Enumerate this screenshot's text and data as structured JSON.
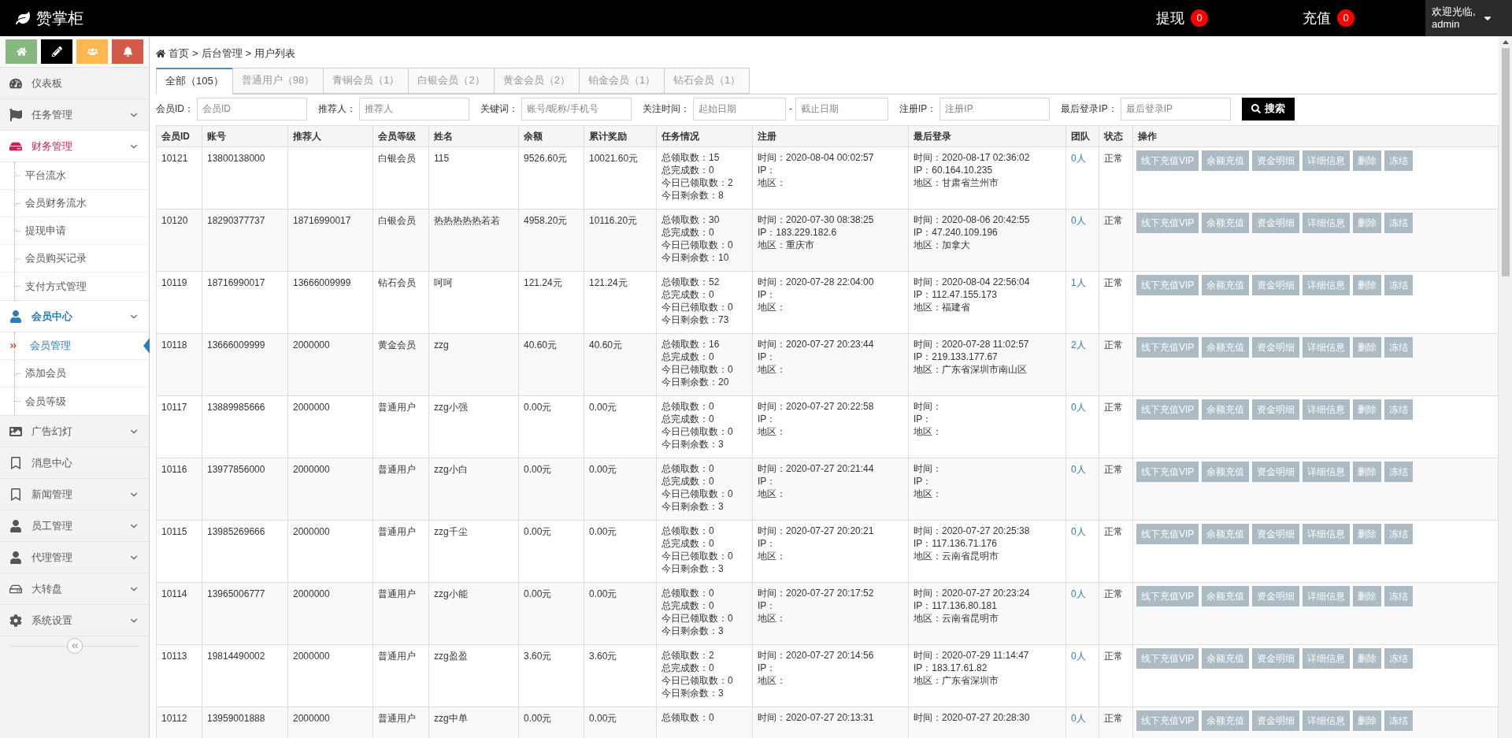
{
  "header": {
    "logo": "赞掌柜",
    "withdraw": {
      "label": "提现",
      "count": "0"
    },
    "recharge": {
      "label": "充值",
      "count": "0"
    },
    "user": {
      "greeting": "欢迎光临,",
      "name": "admin"
    }
  },
  "sidebar": {
    "shortcuts": [
      {
        "color": "#87b87f"
      },
      {
        "color": "#000000"
      },
      {
        "color": "#ffb752"
      },
      {
        "color": "#d15b47"
      }
    ],
    "menu": [
      {
        "label": "仪表板",
        "expandable": false,
        "selected": false
      },
      {
        "label": "任务管理",
        "expandable": true,
        "selected": false
      },
      {
        "label": "财务管理",
        "expandable": true,
        "selected": false,
        "color": "#c7254e",
        "expanded": true,
        "children": [
          {
            "label": "平台流水",
            "selected": false
          },
          {
            "label": "会员财务流水",
            "selected": false
          },
          {
            "label": "提现申请",
            "selected": false
          },
          {
            "label": "会员购买记录",
            "selected": false
          },
          {
            "label": "支付方式管理",
            "selected": false
          }
        ]
      },
      {
        "label": "会员中心",
        "expandable": true,
        "selected": true,
        "expanded": true,
        "children": [
          {
            "label": "会员管理",
            "selected": true
          },
          {
            "label": "添加会员",
            "selected": false
          },
          {
            "label": "会员等级",
            "selected": false
          }
        ]
      },
      {
        "label": "广告幻灯",
        "expandable": true,
        "selected": false
      },
      {
        "label": "消息中心",
        "expandable": false,
        "selected": false
      },
      {
        "label": "新闻管理",
        "expandable": true,
        "selected": false
      },
      {
        "label": "员工管理",
        "expandable": true,
        "selected": false
      },
      {
        "label": "代理管理",
        "expandable": true,
        "selected": false
      },
      {
        "label": "大转盘",
        "expandable": true,
        "selected": false
      },
      {
        "label": "系统设置",
        "expandable": true,
        "selected": false
      }
    ]
  },
  "breadcrumb": [
    "首页",
    ">",
    "后台管理",
    ">",
    "用户列表"
  ],
  "tabs": [
    {
      "label": "全部（105）",
      "selected": true
    },
    {
      "label": "普通用户（98）",
      "selected": false
    },
    {
      "label": "青铜会员（1）",
      "selected": false
    },
    {
      "label": "白银会员（2）",
      "selected": false
    },
    {
      "label": "黄金会员（2）",
      "selected": false
    },
    {
      "label": "铂金会员（1）",
      "selected": false
    },
    {
      "label": "钻石会员（1）",
      "selected": false
    }
  ],
  "filters": [
    {
      "label": "会员ID：",
      "fields": [
        {
          "placeholder": "会员ID"
        }
      ]
    },
    {
      "label": "推荐人：",
      "fields": [
        {
          "placeholder": "推荐人"
        }
      ]
    },
    {
      "label": "关键词：",
      "fields": [
        {
          "placeholder": "账号/昵称/手机号"
        }
      ]
    },
    {
      "label": "关注时间：",
      "fields": [
        {
          "placeholder": "起始日期"
        },
        {
          "placeholder": "截止日期"
        }
      ],
      "separator": "-"
    },
    {
      "label": "注册IP：",
      "fields": [
        {
          "placeholder": "注册IP"
        }
      ]
    },
    {
      "label": "最后登录IP：",
      "fields": [
        {
          "placeholder": "最后登录IP"
        }
      ]
    }
  ],
  "search_button": "搜索",
  "table": {
    "columns": [
      "会员ID",
      "账号",
      "推荐人",
      "会员等级",
      "姓名",
      "余额",
      "累计奖励",
      "任务情况",
      "注册",
      "最后登录",
      "团队",
      "状态",
      "操作"
    ],
    "rows": [
      {
        "id": "10121",
        "account": "13800138000",
        "level": "白银会员",
        "name": "115",
        "balance": "9526.60元",
        "reward": "10021.60元",
        "tasks": [
          "总领取数：15",
          "总完成数：0",
          "今日已领取数：2",
          "今日剩余数：8"
        ],
        "register": [
          "时间：2020-08-04 00:02:57",
          "IP：",
          "地区："
        ],
        "last_login": [
          "时间：2020-08-17 02:36:02",
          "IP：60.164.10.235",
          "地区：甘肃省兰州市"
        ],
        "team": "0人",
        "status": "正常",
        "actions": [
          "线下充值VIP",
          "余额充值",
          "资金明细",
          "详细信息",
          "删除",
          "冻结"
        ]
      },
      {
        "id": "10120",
        "account": "18290377737",
        "referrer": "18716990017",
        "level": "白银会员",
        "name": "热热热热热若若",
        "balance": "4958.20元",
        "reward": "10116.20元",
        "tasks": [
          "总领取数：30",
          "总完成数：0",
          "今日已领取数：0",
          "今日剩余数：10"
        ],
        "register": [
          "时间：2020-07-30 08:38:25",
          "IP：183.229.182.6",
          "地区：重庆市"
        ],
        "last_login": [
          "时间：2020-08-06 20:42:55",
          "IP：47.240.109.196",
          "地区：加拿大"
        ],
        "team": "0人",
        "status": "正常",
        "actions": [
          "线下充值VIP",
          "余额充值",
          "资金明细",
          "详细信息",
          "删除",
          "冻结"
        ]
      },
      {
        "id": "10119",
        "account": "18716990017",
        "referrer": "13666009999",
        "level": "钻石会员",
        "name": "呵呵",
        "balance": "121.24元",
        "reward": "121.24元",
        "tasks": [
          "总领取数：52",
          "总完成数：0",
          "今日已领取数：0",
          "今日剩余数：73"
        ],
        "register": [
          "时间：2020-07-28 22:04:00",
          "IP：",
          "地区："
        ],
        "last_login": [
          "时间：2020-08-04 22:56:04",
          "IP：112.47.155.173",
          "地区：福建省"
        ],
        "team": "1人",
        "status": "正常",
        "actions": [
          "线下充值VIP",
          "余额充值",
          "资金明细",
          "详细信息",
          "删除",
          "冻结"
        ]
      },
      {
        "id": "10118",
        "account": "13666009999",
        "referrer": "2000000",
        "level": "黄金会员",
        "name": "zzg",
        "balance": "40.60元",
        "reward": "40.60元",
        "tasks": [
          "总领取数：16",
          "总完成数：0",
          "今日已领取数：0",
          "今日剩余数：20"
        ],
        "register": [
          "时间：2020-07-27 20:23:44",
          "IP：",
          "地区："
        ],
        "last_login": [
          "时间：2020-07-28 11:02:57",
          "IP：219.133.177.67",
          "地区：广东省深圳市南山区"
        ],
        "team": "2人",
        "status": "正常",
        "actions": [
          "线下充值VIP",
          "余额充值",
          "资金明细",
          "详细信息",
          "删除",
          "冻结"
        ]
      },
      {
        "id": "10117",
        "account": "13889985666",
        "referrer": "2000000",
        "level": "普通用户",
        "name": "zzg小强",
        "balance": "0.00元",
        "reward": "0.00元",
        "tasks": [
          "总领取数：0",
          "总完成数：0",
          "今日已领取数：0",
          "今日剩余数：3"
        ],
        "register": [
          "时间：2020-07-27 20:22:58",
          "IP：",
          "地区："
        ],
        "last_login": [
          "时间：",
          "IP：",
          "地区："
        ],
        "team": "0人",
        "status": "正常",
        "actions": [
          "线下充值VIP",
          "余额充值",
          "资金明细",
          "详细信息",
          "删除",
          "冻结"
        ]
      },
      {
        "id": "10116",
        "account": "13977856000",
        "referrer": "2000000",
        "level": "普通用户",
        "name": "zzg小白",
        "balance": "0.00元",
        "reward": "0.00元",
        "tasks": [
          "总领取数：0",
          "总完成数：0",
          "今日已领取数：0",
          "今日剩余数：3"
        ],
        "register": [
          "时间：2020-07-27 20:21:44",
          "IP：",
          "地区："
        ],
        "last_login": [
          "时间：",
          "IP：",
          "地区："
        ],
        "team": "0人",
        "status": "正常",
        "actions": [
          "线下充值VIP",
          "余额充值",
          "资金明细",
          "详细信息",
          "删除",
          "冻结"
        ]
      },
      {
        "id": "10115",
        "account": "13985269666",
        "referrer": "2000000",
        "level": "普通用户",
        "name": "zzg千尘",
        "balance": "0.00元",
        "reward": "0.00元",
        "tasks": [
          "总领取数：0",
          "总完成数：0",
          "今日已领取数：0",
          "今日剩余数：3"
        ],
        "register": [
          "时间：2020-07-27 20:20:21",
          "IP：",
          "地区："
        ],
        "last_login": [
          "时间：2020-07-27 20:25:38",
          "IP：117.136.71.176",
          "地区：云南省昆明市"
        ],
        "team": "0人",
        "status": "正常",
        "actions": [
          "线下充值VIP",
          "余额充值",
          "资金明细",
          "详细信息",
          "删除",
          "冻结"
        ]
      },
      {
        "id": "10114",
        "account": "13965006777",
        "referrer": "2000000",
        "level": "普通用户",
        "name": "zzg小能",
        "balance": "0.00元",
        "reward": "0.00元",
        "tasks": [
          "总领取数：0",
          "总完成数：0",
          "今日已领取数：0",
          "今日剩余数：3"
        ],
        "register": [
          "时间：2020-07-27 20:17:52",
          "IP：",
          "地区："
        ],
        "last_login": [
          "时间：2020-07-27 20:23:24",
          "IP：117.136.80.181",
          "地区：云南省昆明市"
        ],
        "team": "0人",
        "status": "正常",
        "actions": [
          "线下充值VIP",
          "余额充值",
          "资金明细",
          "详细信息",
          "删除",
          "冻结"
        ]
      },
      {
        "id": "10113",
        "account": "19814490002",
        "referrer": "2000000",
        "level": "普通用户",
        "name": "zzg盈盈",
        "balance": "3.60元",
        "reward": "3.60元",
        "tasks": [
          "总领取数：2",
          "总完成数：0",
          "今日已领取数：0",
          "今日剩余数：3"
        ],
        "register": [
          "时间：2020-07-27 20:14:56",
          "IP：",
          "地区："
        ],
        "last_login": [
          "时间：2020-07-29 11:14:47",
          "IP：183.17.61.82",
          "地区：广东省深圳市"
        ],
        "team": "0人",
        "status": "正常",
        "actions": [
          "线下充值VIP",
          "余额充值",
          "资金明细",
          "详细信息",
          "删除",
          "冻结"
        ]
      },
      {
        "id": "10112",
        "account": "13959001888",
        "referrer": "2000000",
        "level": "普通用户",
        "name": "zzg中单",
        "balance": "0.00元",
        "reward": "0.00元",
        "tasks": [
          "总领取数：0"
        ],
        "register": [
          "时间：2020-07-27 20:13:31"
        ],
        "last_login": [
          "时间：2020-07-27 20:28:30"
        ],
        "team": "0人",
        "status": "正常",
        "actions": [
          "线下充值VIP",
          "余额充值",
          "资金明细",
          "详细信息",
          "删除",
          "冻结"
        ]
      }
    ]
  }
}
